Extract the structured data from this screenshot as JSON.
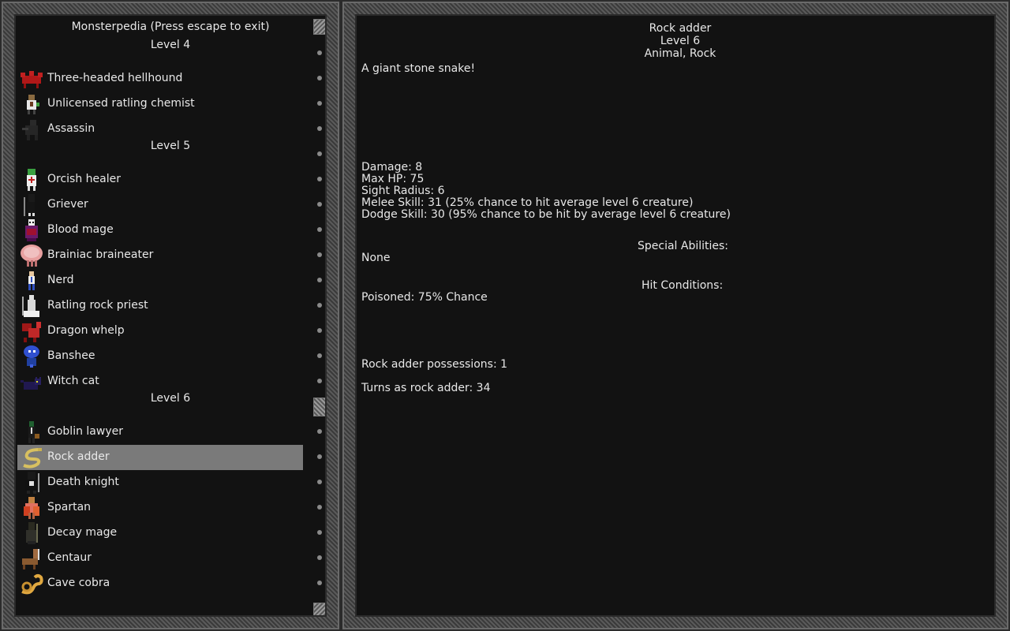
{
  "list": {
    "title": "Monsterpedia (Press escape to exit)",
    "levels": [
      {
        "label": "Level 4",
        "monsters": [
          "Three-headed hellhound",
          "Unlicensed ratling chemist",
          "Assassin"
        ]
      },
      {
        "label": "Level 5",
        "monsters": [
          "Orcish healer",
          "Griever",
          "Blood mage",
          "Brainiac braineater",
          "Nerd",
          "Ratling rock priest",
          "Dragon whelp",
          "Banshee",
          "Witch cat"
        ]
      },
      {
        "label": "Level 6",
        "monsters": [
          "Goblin lawyer",
          "Rock adder",
          "Death knight",
          "Spartan",
          "Decay mage",
          "Centaur",
          "Cave cobra"
        ]
      }
    ],
    "selected": "Rock adder"
  },
  "detail": {
    "name": "Rock adder",
    "level": "Level 6",
    "types": "Animal, Rock",
    "description": "A giant stone snake!",
    "stats": {
      "damage": "Damage: 8",
      "max_hp": "Max HP: 75",
      "sight": "Sight Radius: 6",
      "melee": "Melee Skill: 31 (25% chance to hit average level 6 creature)",
      "dodge": "Dodge Skill: 30 (95% chance to be hit by average level 6 creature)"
    },
    "special_heading": "Special Abilities:",
    "special_value": "None",
    "hit_heading": "Hit Conditions:",
    "hit_value": "Poisoned: 75% Chance",
    "possessions": "Rock adder possessions: 1",
    "turns": "Turns as rock adder: 34"
  }
}
